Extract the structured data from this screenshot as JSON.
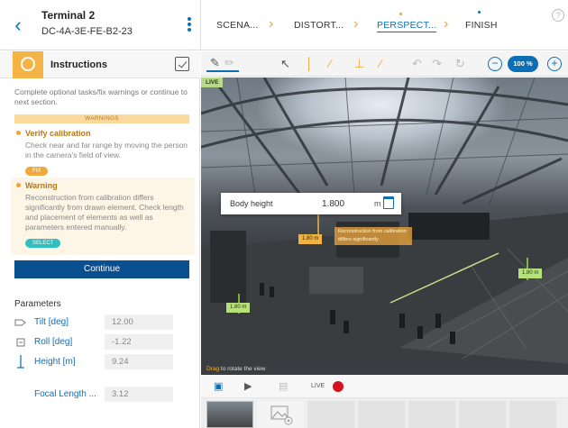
{
  "header": {
    "device_title": "Terminal 2",
    "device_id": "DC-4A-3E-FE-B2-23",
    "help": "?",
    "steps": [
      {
        "label": "SCENA..."
      },
      {
        "label": "DISTORT..."
      },
      {
        "label": "PERSPECT..."
      },
      {
        "label": "FINISH"
      }
    ]
  },
  "instructions": {
    "title": "Instructions",
    "intro": "Complete optional tasks/fix warnings or continue to next section.",
    "warnings_label": "WARNINGS",
    "verify": {
      "title": "Verify calibration",
      "text": "Check near and far range by moving the person in the camera's field of view.",
      "chip": "FIX"
    },
    "warning": {
      "title": "Warning",
      "text": "Reconstruction from calibration differs significantly from drawn element. Check length and placement of elements as well as parameters entered manually.",
      "chip": "SELECT"
    },
    "continue_label": "Continue"
  },
  "parameters": {
    "title": "Parameters",
    "rows": [
      {
        "label": "Tilt [deg]",
        "value": "12.00",
        "icon": "tilt-icon"
      },
      {
        "label": "Roll [deg]",
        "value": "-1.22",
        "icon": "roll-icon"
      },
      {
        "label": "Height [m]",
        "value": "9.24",
        "icon": "height-icon"
      },
      {
        "label": "Focal Length ...",
        "value": "3.12",
        "icon": ""
      }
    ]
  },
  "toolbar": {
    "zoom": "100 %"
  },
  "video": {
    "live_tag": "LIVE",
    "popover": {
      "label": "Body height",
      "value": "1.800",
      "unit": "m"
    },
    "measure_orange": "1.80 m",
    "measure_green_right": "1.80 m",
    "measure_green_left": "1.80 m",
    "warning_tip": "Reconstruction from calibration differs significantly",
    "drag_hint_bold": "Drag",
    "drag_hint_rest": " to rotate the view"
  },
  "bottom": {
    "live_label": "LIVE"
  },
  "colors": {
    "accent": "#0b6fb8",
    "warning": "#f2a33a",
    "continue_bg": "#0a4f8f",
    "record": "#d4111c"
  }
}
